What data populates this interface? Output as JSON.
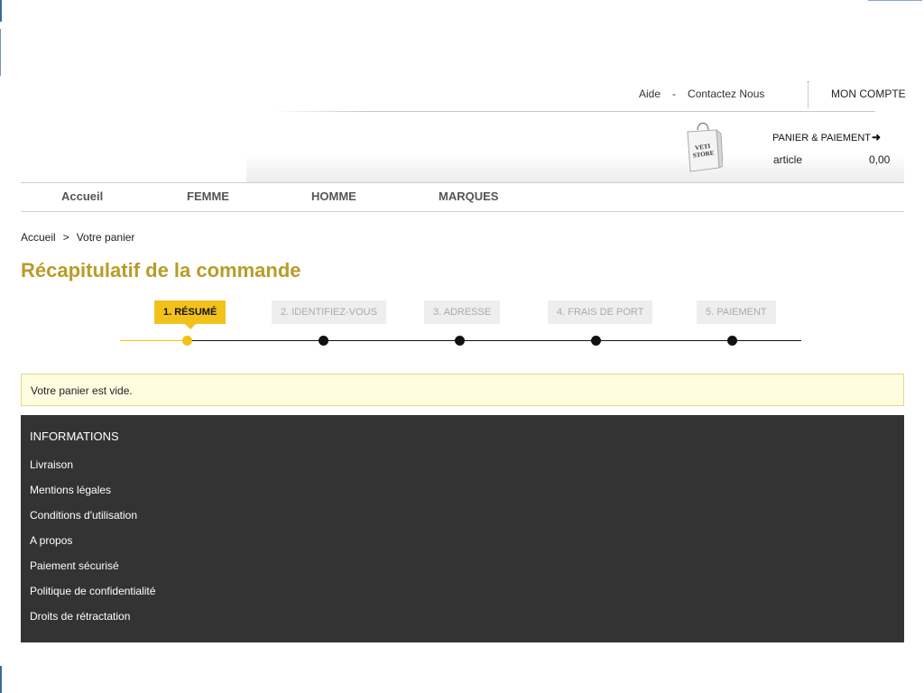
{
  "top_bar": {
    "help": "Aide",
    "separator": "-",
    "contact": "Contactez Nous",
    "account": "MON COMPTE"
  },
  "cart": {
    "bag_brand_line1": "VETI",
    "bag_brand_line2": "STORE",
    "title": "PANIER & PAIEMENT",
    "arrow": "➜",
    "article_label": "article",
    "amount": "0,00"
  },
  "nav": {
    "items": [
      {
        "label": "Accueil"
      },
      {
        "label": "FEMME"
      },
      {
        "label": "HOMME"
      },
      {
        "label": "MARQUES"
      }
    ]
  },
  "breadcrumb": {
    "home": "Accueil",
    "separator": ">",
    "current": "Votre panier"
  },
  "page": {
    "title": "Récapitulatif de la commande"
  },
  "steps": {
    "items": [
      {
        "label": "1. Résumé",
        "active": true
      },
      {
        "label": "2. Identifiez-vous",
        "active": false
      },
      {
        "label": "3. Adresse",
        "active": false
      },
      {
        "label": "4. Frais de port",
        "active": false
      },
      {
        "label": "5. Paiement",
        "active": false
      }
    ]
  },
  "notice": {
    "message": "Votre panier est vide."
  },
  "footer": {
    "title": "INFORMATIONS",
    "links": [
      {
        "label": "Livraison"
      },
      {
        "label": "Mentions légales"
      },
      {
        "label": "Conditions d'utilisation"
      },
      {
        "label": "A propos"
      },
      {
        "label": "Paiement sécurisé"
      },
      {
        "label": "Politique de confidentialité"
      },
      {
        "label": "Droits de rétractation"
      }
    ]
  },
  "colors": {
    "accent": "#b89c28",
    "step_active": "#f2c21a",
    "footer_bg": "#333333",
    "notice_bg": "#fffde0"
  }
}
